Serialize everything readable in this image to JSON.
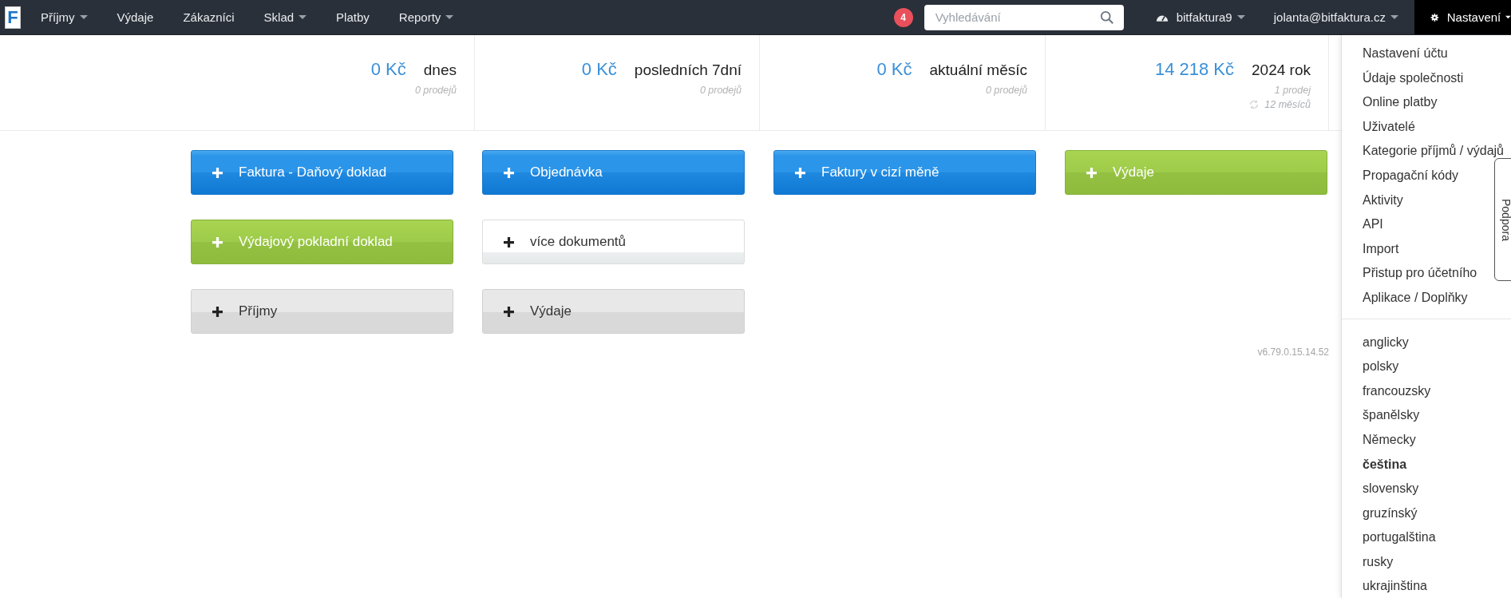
{
  "nav": {
    "logo": "F",
    "items": [
      {
        "label": "Příjmy",
        "has_menu": true
      },
      {
        "label": "Výdaje",
        "has_menu": false
      },
      {
        "label": "Zákazníci",
        "has_menu": false
      },
      {
        "label": "Sklad",
        "has_menu": true
      },
      {
        "label": "Platby",
        "has_menu": false
      },
      {
        "label": "Reporty",
        "has_menu": true
      }
    ],
    "notifications": "4",
    "search": {
      "placeholder": "Vyhledávání"
    },
    "right_items": [
      {
        "kind": "dashboard",
        "label": "bitfaktura9",
        "selected": false
      },
      {
        "kind": "plain",
        "label": "jolanta@bitfaktura.cz",
        "selected": false
      },
      {
        "kind": "settings",
        "label": "Nastavení",
        "selected": true
      }
    ]
  },
  "stats": [
    {
      "amount": "0 Kč",
      "period": "dnes",
      "count": "0 prodejů"
    },
    {
      "amount": "0 Kč",
      "period": "posledních 7dní",
      "count": "0 prodejů"
    },
    {
      "amount": "0 Kč",
      "period": "aktuální měsíc",
      "count": "0 prodejů"
    },
    {
      "amount": "14 218 Kč",
      "period": "2024 rok",
      "count": "1 prodej",
      "range": "12 měsíců"
    }
  ],
  "buttons": [
    {
      "label": "Faktura - Daňový doklad",
      "kind": "primary"
    },
    {
      "label": "Objednávka",
      "kind": "primary"
    },
    {
      "label": "Faktury v cizí měně",
      "kind": "primary"
    },
    {
      "label": "Výdaje",
      "kind": "success"
    },
    {
      "label": "Výdajový pokladní doklad",
      "kind": "success"
    },
    {
      "label": "více dokumentů",
      "kind": "white"
    },
    {
      "label": "Příjmy",
      "kind": "grey"
    },
    {
      "label": "Výdaje",
      "kind": "grey"
    }
  ],
  "version": "v6.79.0.15.14.52",
  "settings_menu": {
    "items": [
      "Nastavení účtu",
      "Údaje společnosti",
      "Online platby",
      "Uživatelé",
      "Kategorie příjmů / výdajů",
      "Propagační kódy",
      "Aktivity",
      "API",
      "Import",
      "Přistup pro účetního",
      "Aplikace / Doplňky"
    ],
    "languages": [
      {
        "label": "anglicky",
        "selected": false
      },
      {
        "label": "polsky",
        "selected": false
      },
      {
        "label": "francouzsky",
        "selected": false
      },
      {
        "label": "španělsky",
        "selected": false
      },
      {
        "label": "Německy",
        "selected": false
      },
      {
        "label": "čeština",
        "selected": true
      },
      {
        "label": "slovensky",
        "selected": false
      },
      {
        "label": "gruzínský",
        "selected": false
      },
      {
        "label": "portugalština",
        "selected": false
      },
      {
        "label": "rusky",
        "selected": false
      },
      {
        "label": "ukrajinština",
        "selected": false
      }
    ]
  },
  "support_tab": "Podpora"
}
